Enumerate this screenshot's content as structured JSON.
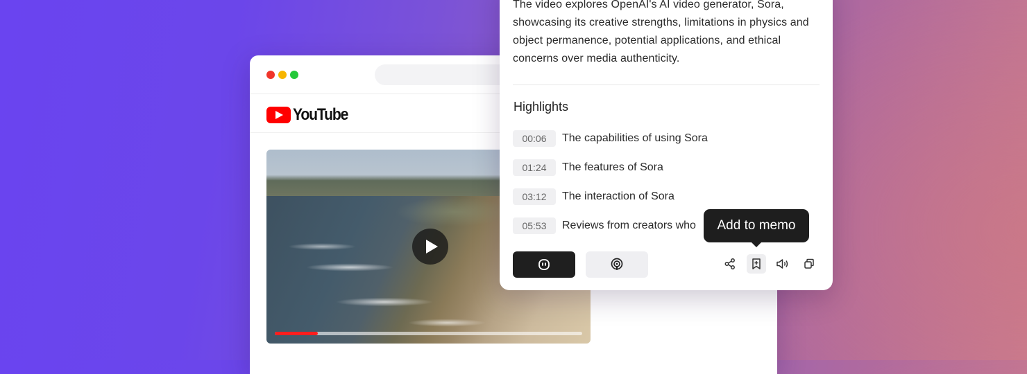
{
  "browser": {
    "traffic_lights": [
      "close",
      "minimize",
      "maximize"
    ]
  },
  "youtube": {
    "logo_text": "YouTube",
    "video": {
      "progress": 0.14,
      "accent": "#ff1e1e"
    }
  },
  "summary_card": {
    "summary_text": "The video explores OpenAI's AI video generator, Sora, showcasing its creative strengths, limitations in physics and object permanence, potential applications, and ethical concerns over media authenticity.",
    "highlights_title": "Highlights",
    "highlights": [
      {
        "time": "00:06",
        "text": "The capabilities of using Sora"
      },
      {
        "time": "01:24",
        "text": "The features of Sora"
      },
      {
        "time": "03:12",
        "text": "The interaction of Sora"
      },
      {
        "time": "05:53",
        "text": "Reviews from creators who"
      }
    ],
    "actions": {
      "chat_icon": "chat-bubble-icon",
      "podcast_icon": "podcast-icon",
      "share_icon": "share-icon",
      "memo_icon": "add-memo-icon",
      "speak_icon": "speaker-icon",
      "copy_icon": "copy-icon"
    },
    "tooltip": "Add to memo"
  }
}
